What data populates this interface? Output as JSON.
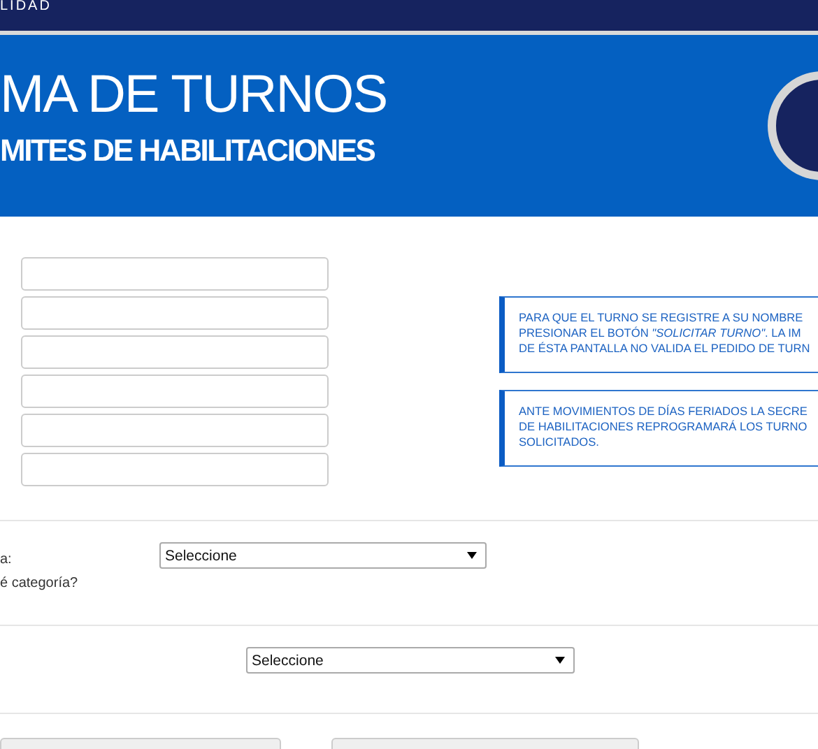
{
  "top_bar": {
    "text": "LIDAD"
  },
  "banner": {
    "title": "MA DE TURNOS",
    "subtitle": "MITES DE HABILITACIONES"
  },
  "fields": [
    {
      "kind": "text"
    },
    {
      "kind": "text"
    },
    {
      "kind": "text"
    },
    {
      "kind": "text"
    },
    {
      "kind": "text"
    },
    {
      "kind": "text"
    }
  ],
  "notices": [
    {
      "lines": [
        "PARA QUE EL TURNO SE REGISTRE A SU NOMBRE",
        "PRESIONAR EL BOTÓN *\"SOLICITAR TURNO\"*. LA IM",
        "DE ÉSTA PANTALLA NO VALIDA EL PEDIDO DE TURN"
      ]
    },
    {
      "lines": [
        "ANTE MOVIMIENTOS DE DÍAS FERIADOS LA SECRE",
        "DE HABILITACIONES REPROGRAMARÁ LOS TURNO",
        "SOLICITADOS."
      ]
    }
  ],
  "category": {
    "label": "a:",
    "help": "é categoría?",
    "select": "Seleccione"
  },
  "second_select": "Seleccione"
}
